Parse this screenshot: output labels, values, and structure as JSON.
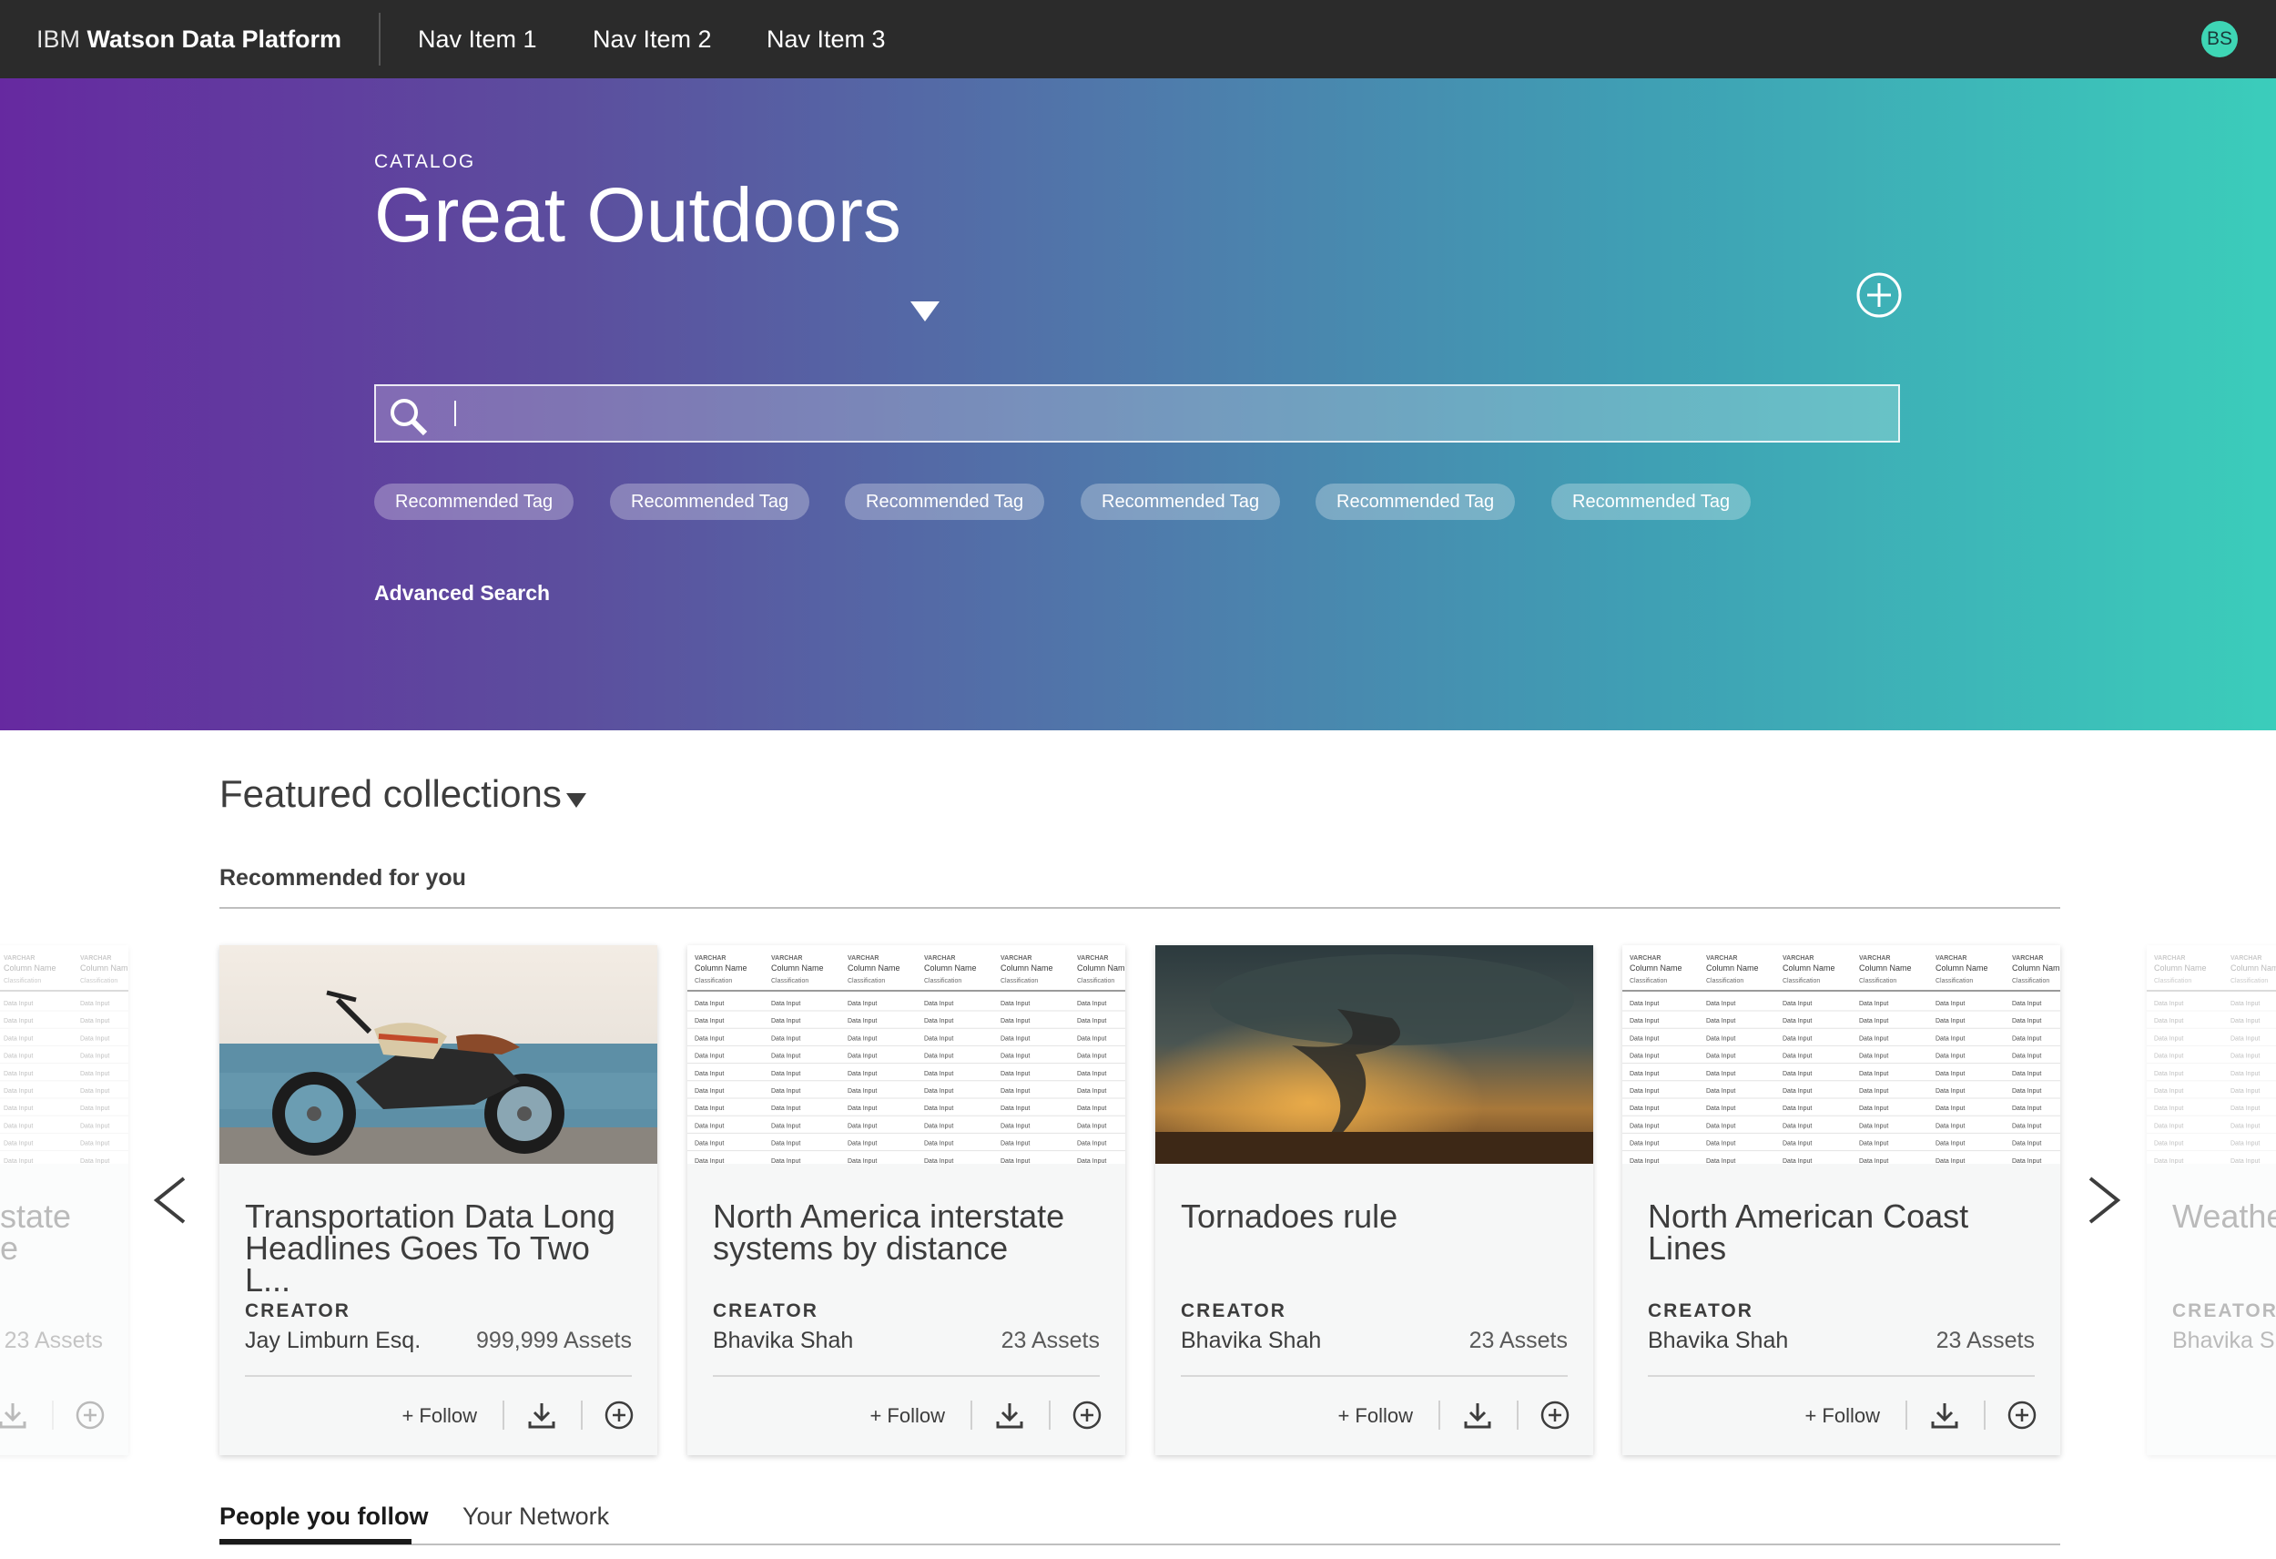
{
  "nav": {
    "brand_prefix": "IBM",
    "brand_name": "Watson Data Platform",
    "items": [
      "Nav Item 1",
      "Nav Item 2",
      "Nav Item 3"
    ],
    "avatar_initials": "BS"
  },
  "hero": {
    "catalog_label": "CATALOG",
    "catalog_title": "Great Outdoors",
    "search_value": "",
    "tags": [
      "Recommended Tag",
      "Recommended Tag",
      "Recommended Tag",
      "Recommended Tag",
      "Recommended Tag",
      "Recommended Tag"
    ],
    "advanced_search": "Advanced Search"
  },
  "collections": {
    "heading": "Featured collections",
    "subheading": "Recommended for you",
    "cards": [
      {
        "title": "Transportation Data Long Headlines Goes To Two L...",
        "creator_label": "CREATOR",
        "creator": "Jay Limburn Esq.",
        "assets": "999,999 Assets",
        "follow": "+ Follow",
        "media": "motorcycle-photo"
      },
      {
        "title": "North America interstate systems by distance",
        "creator_label": "CREATOR",
        "creator": "Bhavika Shah",
        "assets": "23 Assets",
        "follow": "+ Follow",
        "media": "data-table"
      },
      {
        "title": "Tornadoes rule",
        "creator_label": "CREATOR",
        "creator": "Bhavika Shah",
        "assets": "23 Assets",
        "follow": "+ Follow",
        "media": "tornado-photo"
      },
      {
        "title": "North American Coast Lines",
        "creator_label": "CREATOR",
        "creator": "Bhavika Shah",
        "assets": "23 Assets",
        "follow": "+ Follow",
        "media": "data-table"
      }
    ],
    "partial_left": {
      "title": "state",
      "title_line2": "e",
      "assets": "23 Assets"
    },
    "partial_right": {
      "title": "Weathe",
      "creator_label": "CREATOR",
      "creator": "Bhavika Sh"
    }
  },
  "table_thumb": {
    "type_label": "VARCHAR",
    "column_label": "Column Name",
    "column_label_cut": "Column Nam",
    "class_label": "Classification",
    "cell_label": "Data Input"
  },
  "tabs": [
    "People you follow",
    "Your Network"
  ],
  "colors": {
    "nav_bg": "#2b2b2b",
    "hero_gradient_start": "#6629a0",
    "hero_gradient_end": "#3bcdbb",
    "avatar": "#3ed6b5"
  }
}
